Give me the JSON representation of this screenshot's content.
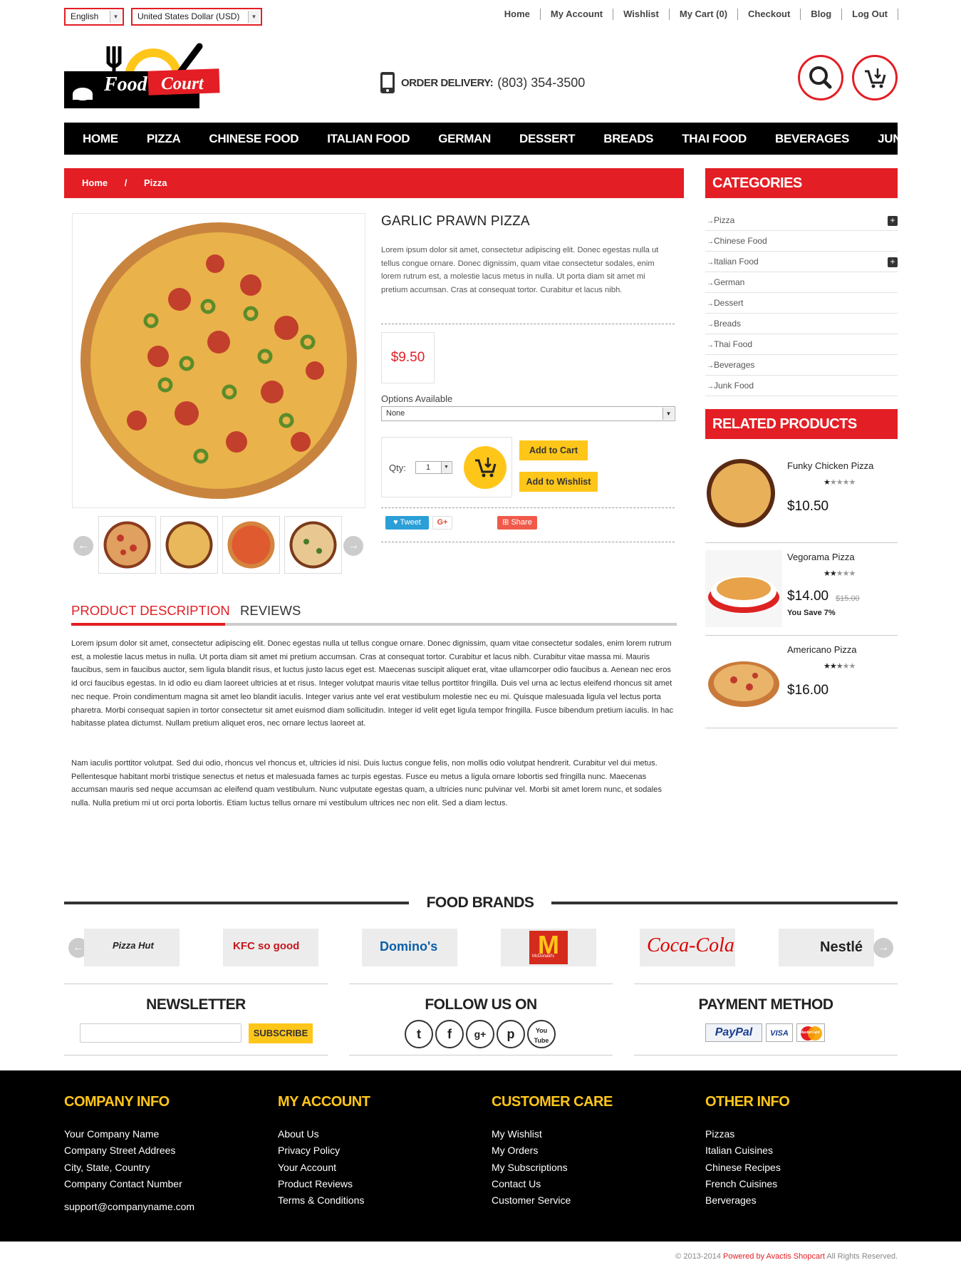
{
  "topbar": {
    "language": "English",
    "currency": "United States Dollar (USD)",
    "links": [
      "Home",
      "My Account",
      "Wishlist",
      "My Cart (0)",
      "Checkout",
      "Blog",
      "Log Out"
    ]
  },
  "header": {
    "logo_text_1": "Food",
    "logo_text_2": "Court",
    "order_label": "ORDER DELIVERY:",
    "phone": "(803) 354-3500"
  },
  "nav": [
    "HOME",
    "PIZZA",
    "CHINESE FOOD",
    "ITALIAN FOOD",
    "GERMAN",
    "DESSERT",
    "BREADS",
    "THAI FOOD",
    "BEVERAGES",
    "JUNK FOOD"
  ],
  "breadcrumb": {
    "home": "Home",
    "sep": "/",
    "current": "Pizza"
  },
  "product": {
    "title": "GARLIC PRAWN PIZZA",
    "short_desc": "Lorem ipsum dolor sit amet, consectetur adipiscing elit. Donec egestas nulla ut tellus congue ornare. Donec dignissim, quam vitae consectetur sodales, enim lorem rutrum est, a molestie lacus metus in nulla. Ut porta diam sit amet mi pretium accumsan. Cras at consequat tortor. Curabitur et lacus nibh.",
    "price": "$9.50",
    "options_label": "Options Available",
    "options_value": "None",
    "qty_label": "Qty:",
    "qty_value": "1",
    "add_to_cart": "Add to Cart",
    "add_to_wishlist": "Add to Wishlist",
    "tweet": "Tweet",
    "gplus": "G+",
    "share": "Share"
  },
  "tabs": {
    "active": "PRODUCT DESCRIPTION",
    "other": "REVIEWS"
  },
  "description": {
    "p1": "Lorem ipsum dolor sit amet, consectetur adipiscing elit. Donec egestas nulla ut tellus congue ornare. Donec dignissim, quam vitae consectetur sodales, enim lorem rutrum est, a molestie lacus metus in nulla. Ut porta diam sit amet mi pretium accumsan. Cras at consequat tortor. Curabitur et lacus nibh. Curabitur vitae massa mi. Mauris faucibus, sem in faucibus auctor, sem ligula blandit risus, et luctus justo lacus eget est. Maecenas suscipit aliquet erat, vitae ullamcorper odio faucibus a. Aenean nec eros id orci faucibus egestas. In id odio eu diam laoreet ultricies at et risus. Integer volutpat mauris vitae tellus porttitor fringilla. Duis vel urna ac lectus eleifend rhoncus sit amet nec neque. Proin condimentum magna sit amet leo blandit iaculis. Integer varius ante vel erat vestibulum molestie nec eu mi. Quisque malesuada ligula vel lectus porta pharetra. Morbi consequat sapien in tortor consectetur sit amet euismod diam sollicitudin. Integer id velit eget ligula tempor fringilla. Fusce bibendum pretium iaculis. In hac habitasse platea dictumst. Nullam pretium aliquet eros, nec ornare lectus laoreet at.",
    "p2": "Nam iaculis porttitor volutpat. Sed dui odio, rhoncus vel rhoncus et, ultricies id nisi. Duis luctus congue felis, non mollis odio volutpat hendrerit. Curabitur vel dui metus. Pellentesque habitant morbi tristique senectus et netus et malesuada fames ac turpis egestas. Fusce eu metus a ligula ornare lobortis sed fringilla nunc. Maecenas accumsan mauris sed neque accumsan ac eleifend quam vestibulum. Nunc vulputate egestas quam, a ultricies nunc pulvinar vel. Morbi sit amet lorem nunc, et sodales nulla. Nulla pretium mi ut orci porta lobortis. Etiam luctus tellus ornare mi vestibulum ultrices nec non elit. Sed a diam lectus."
  },
  "sidebar": {
    "categories_title": "CATEGORIES",
    "categories": [
      {
        "label": "Pizza",
        "expandable": true
      },
      {
        "label": "Chinese Food",
        "expandable": false
      },
      {
        "label": "Italian Food",
        "expandable": true
      },
      {
        "label": "German",
        "expandable": false
      },
      {
        "label": "Dessert",
        "expandable": false
      },
      {
        "label": "Breads",
        "expandable": false
      },
      {
        "label": "Thai Food",
        "expandable": false
      },
      {
        "label": "Beverages",
        "expandable": false
      },
      {
        "label": "Junk Food",
        "expandable": false
      }
    ],
    "related_title": "RELATED PRODUCTS",
    "related": [
      {
        "name": "Funky Chicken Pizza",
        "rating": 1,
        "price": "$10.50",
        "old_price": "",
        "save": ""
      },
      {
        "name": "Vegorama Pizza",
        "rating": 2,
        "price": "$14.00",
        "old_price": "$15.00",
        "save": "You Save 7%"
      },
      {
        "name": "Americano Pizza",
        "rating": 2.5,
        "price": "$16.00",
        "old_price": "",
        "save": ""
      }
    ]
  },
  "brands": {
    "title": "FOOD BRANDS",
    "items": [
      "Pizza Hut",
      "KFC so good",
      "Domino's",
      "McDonald's",
      "Coca-Cola",
      "Nestlé"
    ]
  },
  "newsletter": {
    "title": "NEWSLETTER",
    "placeholder": "",
    "button": "SUBSCRIBE"
  },
  "follow": {
    "title": "FOLLOW US ON",
    "icons": [
      "twitter-icon",
      "facebook-icon",
      "google-plus-icon",
      "pinterest-icon",
      "youtube-icon"
    ]
  },
  "payment": {
    "title": "PAYMENT METHOD",
    "methods": [
      "PayPal",
      "VISA",
      "MasterCard"
    ]
  },
  "footer": {
    "company_info": {
      "title": "COMPANY INFO",
      "items": [
        "Your Company Name",
        "Company Street Addrees",
        "City, State, Country",
        "Company Contact Number"
      ],
      "email": "support@companyname.com"
    },
    "my_account": {
      "title": "MY ACCOUNT",
      "items": [
        "About Us",
        "Privacy Policy",
        "Your Account",
        "Product Reviews",
        "Terms & Conditions"
      ]
    },
    "customer_care": {
      "title": "CUSTOMER CARE",
      "items": [
        "My Wishlist",
        "My Orders",
        "My Subscriptions",
        "Contact Us",
        "Customer Service"
      ]
    },
    "other_info": {
      "title": "OTHER INFO",
      "items": [
        "Pizzas",
        "Italian Cuisines",
        "Chinese Recipes",
        "French Cuisines",
        "Berverages"
      ]
    },
    "copyright_pre": "© 2013-2014",
    "powered": "Powered by Avactis Shopcart",
    "rights": "All Rights Reserved."
  },
  "colors": {
    "accent": "#e31e24",
    "yellow": "#ffc61a",
    "dark": "#000000"
  }
}
